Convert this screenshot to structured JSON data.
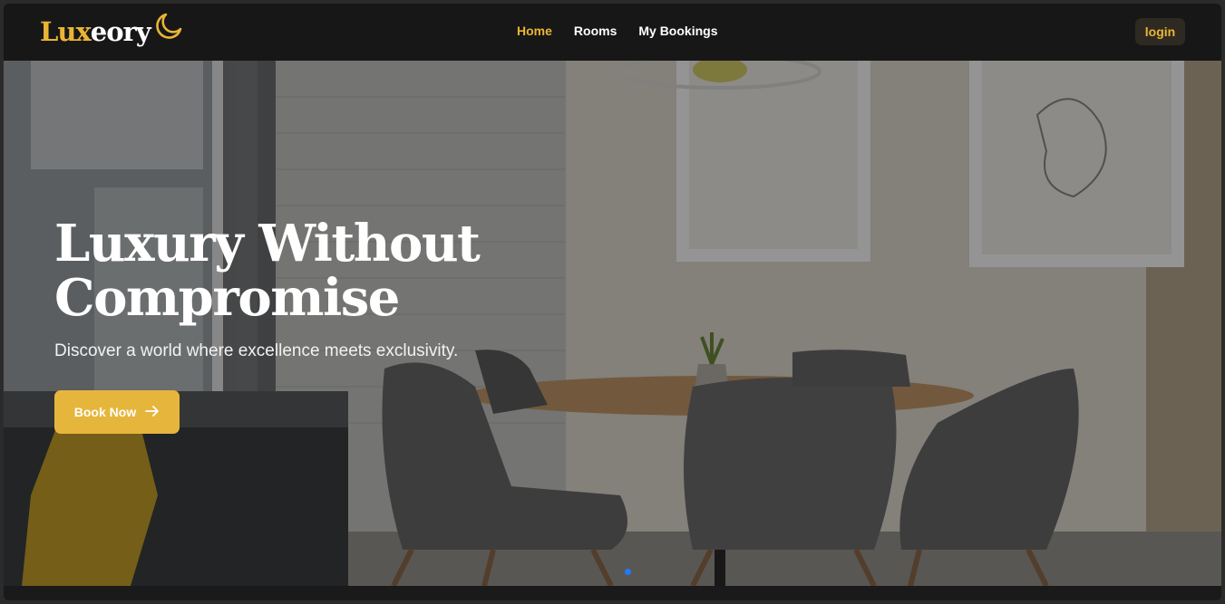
{
  "brand": {
    "part1": "Lux",
    "part2": "eory",
    "icon": "crescent-moon-icon",
    "accent": "#eab534"
  },
  "nav": {
    "items": [
      {
        "label": "Home",
        "active": true
      },
      {
        "label": "Rooms",
        "active": false
      },
      {
        "label": "My Bookings",
        "active": false
      }
    ],
    "login_label": "login"
  },
  "hero": {
    "title": "Luxury Without Compromise",
    "subtitle": "Discover a world where excellence meets exclusivity.",
    "cta_label": "Book Now",
    "cta_icon": "arrow-right-icon",
    "carousel_active_index": 0,
    "carousel_dot_color": "#1f7aff"
  }
}
